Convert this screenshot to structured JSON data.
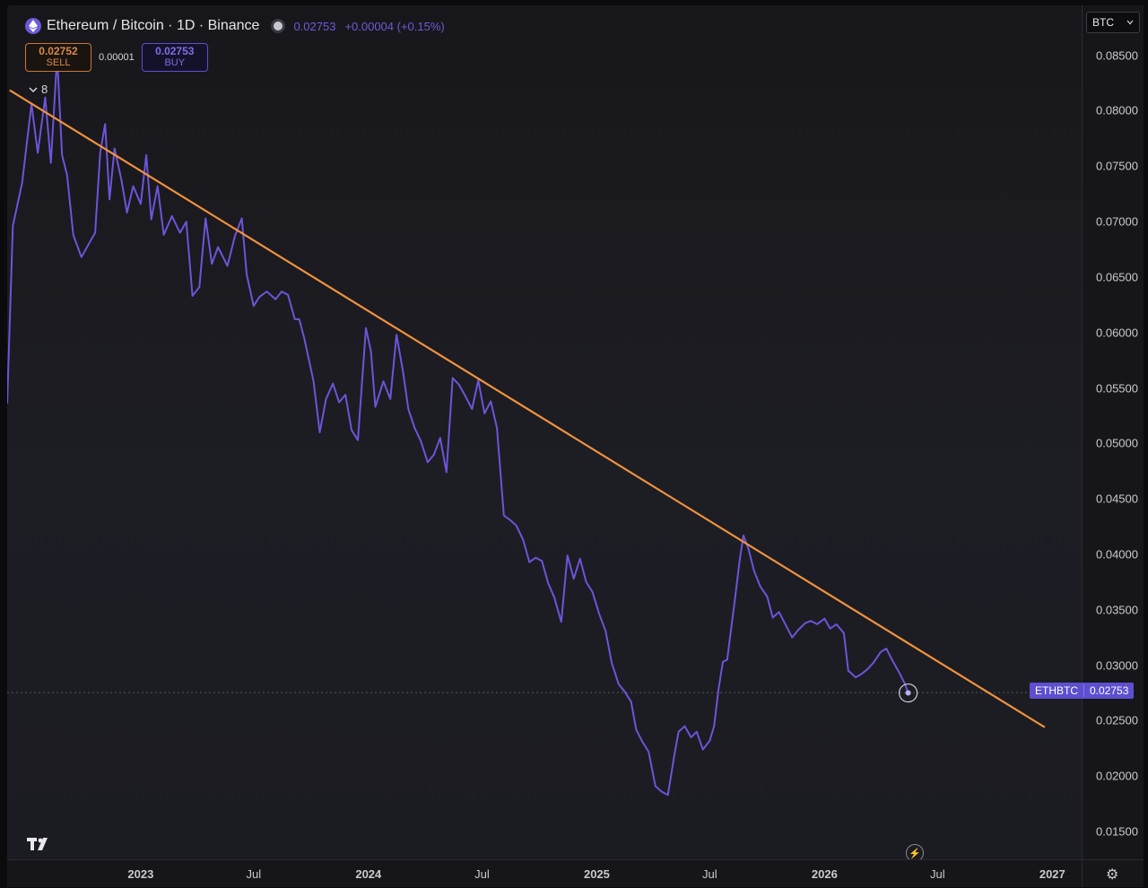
{
  "header": {
    "title": "Ethereum / Bitcoin · 1D · Binance",
    "last_price": "0.02753",
    "change": "+0.00004 (+0.15%)"
  },
  "trade": {
    "sell_price": "0.02752",
    "sell_label": "SELL",
    "spread": "0.00001",
    "buy_price": "0.02753",
    "buy_label": "BUY"
  },
  "indicators_count": "8",
  "currency": "BTC",
  "price_label": {
    "symbol": "ETHBTC",
    "value": "0.02753"
  },
  "icons": {
    "logo": "tradingview-logo",
    "eth": "ethereum-icon",
    "bolt": "lightning-icon",
    "settings": "gear-icon"
  },
  "colors": {
    "series": "#6e54d8",
    "trendline": "#f0913e",
    "price_label": "#5d4fd0"
  },
  "chart_data": {
    "type": "line",
    "ylim": [
      0.0125,
      0.0895
    ],
    "xlim": [
      "2022-06-01",
      "2027-02-17"
    ],
    "y_ticks": [
      "0.01500",
      "0.02000",
      "0.02500",
      "0.03000",
      "0.03500",
      "0.04000",
      "0.04500",
      "0.05000",
      "0.05500",
      "0.06000",
      "0.06500",
      "0.07000",
      "0.07500",
      "0.08000",
      "0.08500"
    ],
    "x_ticks": [
      {
        "label": "2023",
        "date": "2023-01-01",
        "major": true
      },
      {
        "label": "Jul",
        "date": "2023-07-01",
        "major": false
      },
      {
        "label": "2024",
        "date": "2024-01-01",
        "major": true
      },
      {
        "label": "Jul",
        "date": "2024-07-01",
        "major": false
      },
      {
        "label": "2025",
        "date": "2025-01-01",
        "major": true
      },
      {
        "label": "Jul",
        "date": "2025-07-01",
        "major": false
      },
      {
        "label": "2026",
        "date": "2026-01-01",
        "major": true
      },
      {
        "label": "Jul",
        "date": "2026-07-01",
        "major": false
      },
      {
        "label": "2027",
        "date": "2027-01-01",
        "major": true
      }
    ],
    "current_price": 0.02753,
    "series": [
      {
        "values": [
          [
            "2022-06-01",
            0.0536
          ],
          [
            "2022-06-10",
            0.0696
          ],
          [
            "2022-06-25",
            0.0735
          ],
          [
            "2022-07-10",
            0.0806
          ],
          [
            "2022-07-20",
            0.0762
          ],
          [
            "2022-08-01",
            0.0812
          ],
          [
            "2022-08-10",
            0.0753
          ],
          [
            "2022-08-20",
            0.0849
          ],
          [
            "2022-08-28",
            0.076
          ],
          [
            "2022-09-05",
            0.0742
          ],
          [
            "2022-09-15",
            0.0688
          ],
          [
            "2022-09-28",
            0.0668
          ],
          [
            "2022-10-10",
            0.068
          ],
          [
            "2022-10-20",
            0.069
          ],
          [
            "2022-10-28",
            0.0762
          ],
          [
            "2022-11-05",
            0.0788
          ],
          [
            "2022-11-12",
            0.072
          ],
          [
            "2022-11-20",
            0.0766
          ],
          [
            "2022-12-01",
            0.0738
          ],
          [
            "2022-12-10",
            0.0708
          ],
          [
            "2022-12-20",
            0.0732
          ],
          [
            "2023-01-01",
            0.0716
          ],
          [
            "2023-01-10",
            0.076
          ],
          [
            "2023-01-18",
            0.0702
          ],
          [
            "2023-01-28",
            0.0732
          ],
          [
            "2023-02-07",
            0.0688
          ],
          [
            "2023-02-20",
            0.0705
          ],
          [
            "2023-03-05",
            0.069
          ],
          [
            "2023-03-15",
            0.07
          ],
          [
            "2023-03-25",
            0.0633
          ],
          [
            "2023-04-05",
            0.0641
          ],
          [
            "2023-04-15",
            0.0703
          ],
          [
            "2023-04-25",
            0.0662
          ],
          [
            "2023-05-05",
            0.0677
          ],
          [
            "2023-05-20",
            0.066
          ],
          [
            "2023-06-01",
            0.0687
          ],
          [
            "2023-06-12",
            0.0703
          ],
          [
            "2023-06-20",
            0.0652
          ],
          [
            "2023-07-01",
            0.0624
          ],
          [
            "2023-07-10",
            0.0632
          ],
          [
            "2023-07-22",
            0.0637
          ],
          [
            "2023-08-05",
            0.063
          ],
          [
            "2023-08-15",
            0.0637
          ],
          [
            "2023-08-25",
            0.0634
          ],
          [
            "2023-09-05",
            0.0612
          ],
          [
            "2023-09-12",
            0.0612
          ],
          [
            "2023-09-20",
            0.0595
          ],
          [
            "2023-10-05",
            0.0556
          ],
          [
            "2023-10-15",
            0.051
          ],
          [
            "2023-10-25",
            0.054
          ],
          [
            "2023-11-05",
            0.0554
          ],
          [
            "2023-11-15",
            0.0537
          ],
          [
            "2023-11-25",
            0.0544
          ],
          [
            "2023-12-05",
            0.0512
          ],
          [
            "2023-12-15",
            0.0503
          ],
          [
            "2023-12-28",
            0.0604
          ],
          [
            "2024-01-05",
            0.0583
          ],
          [
            "2024-01-12",
            0.0533
          ],
          [
            "2024-01-25",
            0.0556
          ],
          [
            "2024-02-05",
            0.054
          ],
          [
            "2024-02-15",
            0.0598
          ],
          [
            "2024-02-25",
            0.0566
          ],
          [
            "2024-03-05",
            0.0531
          ],
          [
            "2024-03-15",
            0.0514
          ],
          [
            "2024-03-25",
            0.0502
          ],
          [
            "2024-04-05",
            0.0483
          ],
          [
            "2024-04-15",
            0.049
          ],
          [
            "2024-04-25",
            0.0505
          ],
          [
            "2024-05-05",
            0.0474
          ],
          [
            "2024-05-15",
            0.0559
          ],
          [
            "2024-05-25",
            0.0553
          ],
          [
            "2024-06-05",
            0.0542
          ],
          [
            "2024-06-15",
            0.0531
          ],
          [
            "2024-06-25",
            0.0557
          ],
          [
            "2024-07-05",
            0.0527
          ],
          [
            "2024-07-15",
            0.0538
          ],
          [
            "2024-07-25",
            0.0514
          ],
          [
            "2024-08-05",
            0.0435
          ],
          [
            "2024-08-15",
            0.0431
          ],
          [
            "2024-08-25",
            0.0426
          ],
          [
            "2024-09-05",
            0.0413
          ],
          [
            "2024-09-15",
            0.0393
          ],
          [
            "2024-09-25",
            0.0397
          ],
          [
            "2024-10-05",
            0.0394
          ],
          [
            "2024-10-15",
            0.0374
          ],
          [
            "2024-10-25",
            0.0361
          ],
          [
            "2024-11-05",
            0.0339
          ],
          [
            "2024-11-15",
            0.0399
          ],
          [
            "2024-11-25",
            0.0378
          ],
          [
            "2024-12-05",
            0.0396
          ],
          [
            "2024-12-15",
            0.0375
          ],
          [
            "2024-12-25",
            0.0366
          ],
          [
            "2025-01-05",
            0.0346
          ],
          [
            "2025-01-15",
            0.0331
          ],
          [
            "2025-01-25",
            0.0302
          ],
          [
            "2025-02-05",
            0.0283
          ],
          [
            "2025-02-15",
            0.0276
          ],
          [
            "2025-02-25",
            0.0267
          ],
          [
            "2025-03-05",
            0.0242
          ],
          [
            "2025-03-15",
            0.0231
          ],
          [
            "2025-03-25",
            0.0222
          ],
          [
            "2025-04-05",
            0.0191
          ],
          [
            "2025-04-15",
            0.0186
          ],
          [
            "2025-04-25",
            0.0183
          ],
          [
            "2025-05-05",
            0.0218
          ],
          [
            "2025-05-12",
            0.024
          ],
          [
            "2025-05-22",
            0.0245
          ],
          [
            "2025-06-01",
            0.0235
          ],
          [
            "2025-06-10",
            0.024
          ],
          [
            "2025-06-20",
            0.0224
          ],
          [
            "2025-07-01",
            0.0232
          ],
          [
            "2025-07-08",
            0.0245
          ],
          [
            "2025-07-15",
            0.0278
          ],
          [
            "2025-07-22",
            0.0303
          ],
          [
            "2025-07-29",
            0.0305
          ],
          [
            "2025-08-10",
            0.0358
          ],
          [
            "2025-08-18",
            0.0395
          ],
          [
            "2025-08-24",
            0.0417
          ],
          [
            "2025-09-01",
            0.0405
          ],
          [
            "2025-09-10",
            0.0385
          ],
          [
            "2025-09-20",
            0.0371
          ],
          [
            "2025-10-01",
            0.0362
          ],
          [
            "2025-10-10",
            0.0343
          ],
          [
            "2025-10-20",
            0.0348
          ],
          [
            "2025-11-01",
            0.0335
          ],
          [
            "2025-11-10",
            0.0325
          ],
          [
            "2025-11-20",
            0.0332
          ],
          [
            "2025-12-01",
            0.0338
          ],
          [
            "2025-12-10",
            0.034
          ],
          [
            "2025-12-20",
            0.0337
          ],
          [
            "2026-01-01",
            0.0342
          ],
          [
            "2026-01-10",
            0.0333
          ],
          [
            "2026-01-20",
            0.0337
          ],
          [
            "2026-02-01",
            0.0329
          ],
          [
            "2026-02-08",
            0.0295
          ],
          [
            "2026-02-20",
            0.0289
          ],
          [
            "2026-03-01",
            0.0292
          ],
          [
            "2026-03-10",
            0.0296
          ],
          [
            "2026-03-20",
            0.0302
          ],
          [
            "2026-04-01",
            0.0312
          ],
          [
            "2026-04-10",
            0.0315
          ],
          [
            "2026-04-20",
            0.0304
          ],
          [
            "2026-05-01",
            0.0293
          ],
          [
            "2026-05-10",
            0.0283
          ],
          [
            "2026-05-15",
            0.0275
          ]
        ]
      },
      {
        "values": [
          [
            "2022-06-05",
            0.08185
          ],
          [
            "2026-12-20",
            0.0244
          ]
        ]
      }
    ]
  }
}
